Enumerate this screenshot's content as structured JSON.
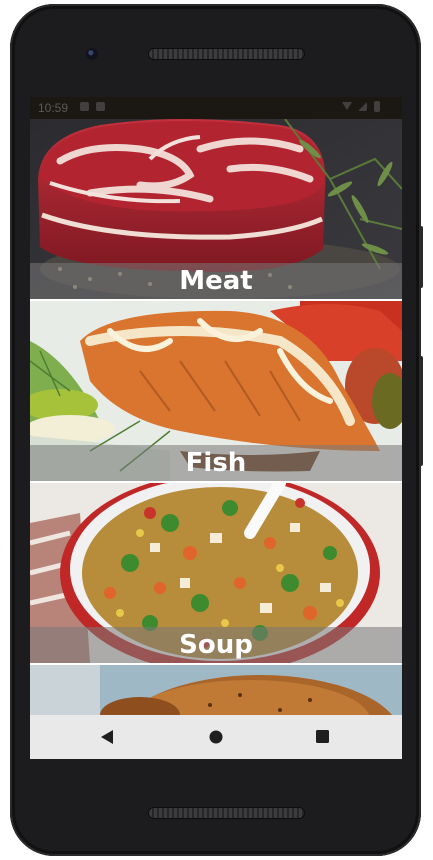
{
  "status_bar": {
    "time": "10:59"
  },
  "categories": [
    {
      "label": "Meat"
    },
    {
      "label": "Fish"
    },
    {
      "label": "Soup"
    },
    {
      "label": ""
    }
  ],
  "nav": {
    "back_icon": "triangle-back",
    "home_icon": "circle-home",
    "recents_icon": "square-recents"
  }
}
